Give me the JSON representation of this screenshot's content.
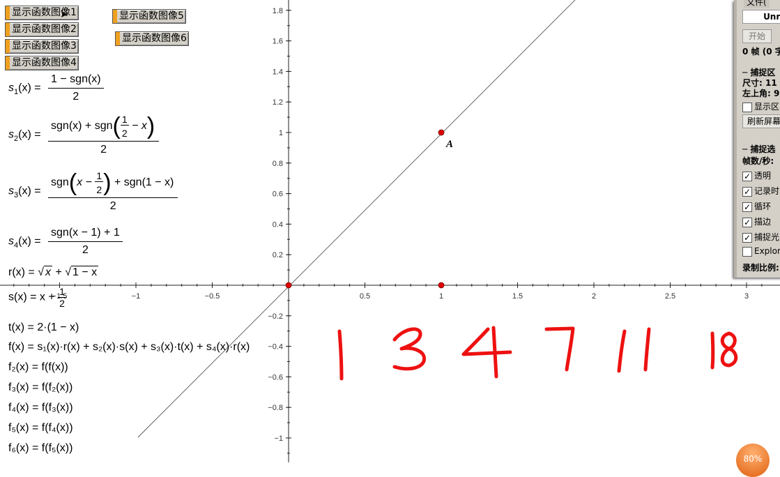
{
  "buttons": [
    {
      "label": "显示函数图像1"
    },
    {
      "label": "显示函数图像2"
    },
    {
      "label": "显示函数图像3"
    },
    {
      "label": "显示函数图像4"
    },
    {
      "label": "显示函数图像5"
    },
    {
      "label": "显示函数图像6"
    }
  ],
  "formulas": {
    "s1": {
      "name": "s",
      "sub": "1",
      "arg": "(x) =",
      "num": "1 − sgn(x)",
      "den": "2"
    },
    "s2": {
      "name": "s",
      "sub": "2",
      "arg": "(x) =",
      "num_a": "sgn(x) + sgn",
      "frac_num": "1",
      "frac_den": "2",
      "num_b": "− x",
      "den": "2"
    },
    "s3": {
      "name": "s",
      "sub": "3",
      "arg": "(x) =",
      "num_a": "sgn",
      "inner_a": "x −",
      "frac_num": "1",
      "frac_den": "2",
      "num_b": "+ sgn(1 − x)",
      "den": "2"
    },
    "s4": {
      "name": "s",
      "sub": "4",
      "arg": "(x) =",
      "num": "sgn(x − 1) + 1",
      "den": "2"
    },
    "r": {
      "lhs": "r(x) =",
      "rad1": "x",
      "plus": "+",
      "rad2": "1 − x"
    },
    "s": {
      "lhs": "s(x) = x +",
      "frac_num": "1",
      "frac_den": "2"
    },
    "t": {
      "text": "t(x) = 2·(1 − x)"
    },
    "f": {
      "text": "f(x) = s₁(x)·r(x) + s₂(x)·s(x) + s₃(x)·t(x) + s₄(x)·r(x)"
    },
    "f2": {
      "text": "f₂(x) = f(f(x))"
    },
    "f3": {
      "text": "f₃(x) = f(f₂(x))"
    },
    "f4": {
      "text": "f₄(x) = f(f₃(x))"
    },
    "f5": {
      "text": "f₅(x) = f(f₄(x))"
    },
    "f6": {
      "text": "f₆(x) = f(f₅(x))"
    }
  },
  "axes": {
    "x_ticks": [
      "−1.5",
      "−1",
      "−0.5",
      "0.5",
      "1",
      "1.5",
      "2",
      "2.5",
      "3"
    ],
    "y_ticks": [
      "1.8",
      "1.6",
      "1.4",
      "1.2",
      "1",
      "0.8",
      "0.6",
      "0.4",
      "0.2",
      "−0.2",
      "−0.4",
      "−0.6",
      "−0.8",
      "−1"
    ]
  },
  "point_label": "A",
  "handwritten": [
    "1",
    "3",
    "4",
    "7",
    "11",
    "18"
  ],
  "colors": {
    "point": "#dd0000",
    "handwriting": "#ee1111",
    "button_accent": "#f0a020"
  },
  "capture_panel": {
    "menu": "文件(",
    "dropdown": "Unreg",
    "start_button": "开始",
    "frames": "0 帧 (0 字",
    "capture_area_title": "捕捉区",
    "size": "尺寸: 11",
    "top_left": "左上角: 9",
    "show_area": "显示区",
    "refresh": "刷新屏幕",
    "options_title": "捕捉选",
    "fps": "帧数/秒:",
    "checks": [
      {
        "label": "透明",
        "checked": true
      },
      {
        "label": "记录时",
        "checked": true
      },
      {
        "label": "循环",
        "checked": true
      },
      {
        "label": "描边",
        "checked": true
      },
      {
        "label": "捕捉光",
        "checked": true
      },
      {
        "label": "Explor",
        "checked": false
      }
    ],
    "record_scale": "录制比例:"
  },
  "zoom": "80%"
}
